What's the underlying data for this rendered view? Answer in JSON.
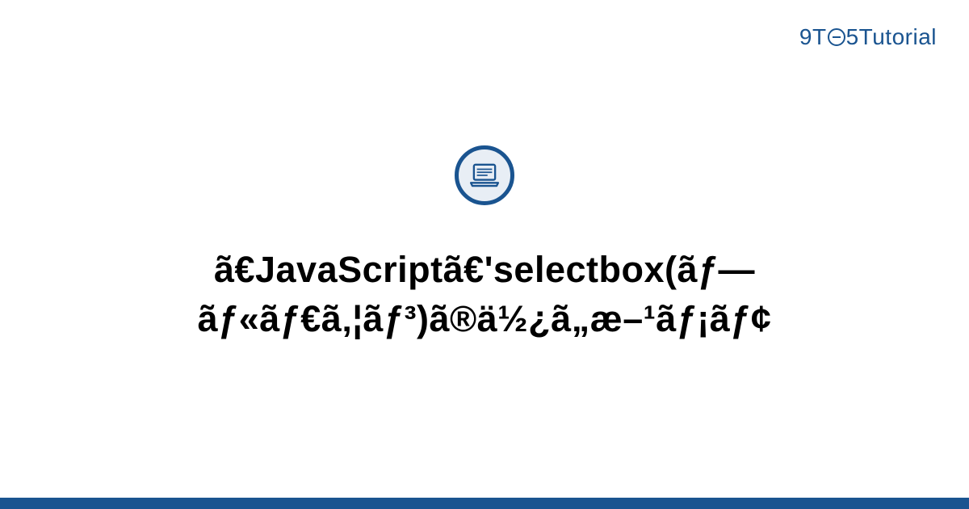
{
  "logo": {
    "nine": "9",
    "t": "T",
    "five": "5",
    "tutorial": "Tutorial"
  },
  "title": "ã€JavaScriptã€'selectbox(ãƒ—ãƒ«ãƒ€ã‚¦ãƒ³)ã®ä½¿ã„æ–¹ãƒ¡ãƒ¢",
  "colors": {
    "brand": "#1a5490",
    "icon_bg": "#e8eef5"
  }
}
